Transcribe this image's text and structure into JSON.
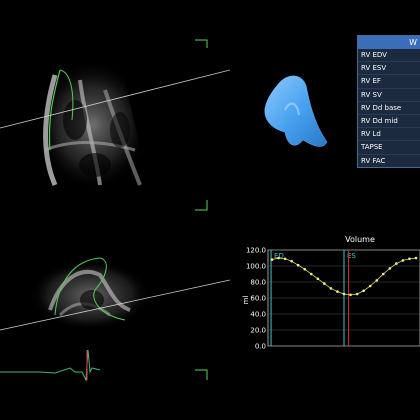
{
  "measurements": {
    "header": "W",
    "rows": [
      "RV EDV",
      "RV ESV",
      "RV EF",
      "RV SV",
      "RV Dd base",
      "RV Dd mid",
      "RV Ld",
      "TAPSE",
      "RV FAC"
    ]
  },
  "chart_data": {
    "type": "line",
    "title": "Volume",
    "xlabel": "",
    "ylabel": "ml",
    "ylim": [
      0,
      120
    ],
    "yticks": [
      "120.0",
      "100.0",
      "80.0",
      "60.0",
      "40.0",
      "20.0",
      "0.0"
    ],
    "markers": [
      {
        "label": "ED",
        "x": 0.02,
        "color": "#3ec8c8"
      },
      {
        "label": "ES",
        "x": 0.5,
        "color": "#3ec8c8"
      },
      {
        "label": "",
        "x": 0.53,
        "color": "#d03030"
      }
    ],
    "series": [
      {
        "values": [
          108,
          110,
          109,
          106,
          101,
          96,
          90,
          84,
          78,
          72,
          68,
          65,
          64,
          65,
          69,
          75,
          82,
          90,
          97,
          103,
          107,
          109,
          110
        ]
      }
    ],
    "grid": true,
    "colors": {
      "line": "#f2f27a",
      "grid": "#666666"
    }
  }
}
